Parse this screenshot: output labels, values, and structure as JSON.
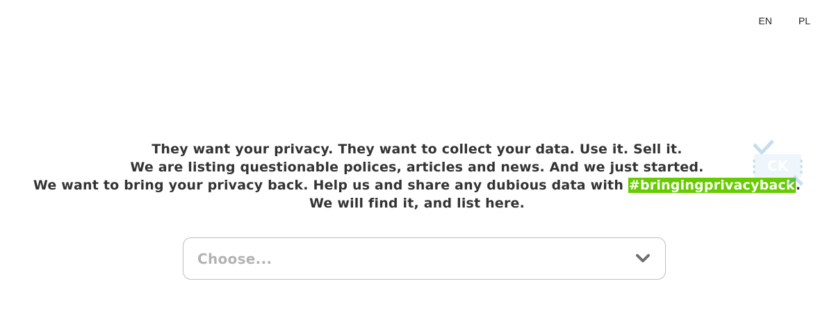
{
  "header": {
    "languages": [
      {
        "label": "EN"
      },
      {
        "label": "PL"
      }
    ]
  },
  "manifesto": {
    "line1": "They want your privacy. They want to collect your data. Use it. Sell it.",
    "line2": "We are listing questionable polices, articles and news. And we just started.",
    "line3_prefix": "We want to bring your privacy back. Help us and share any dubious data with ",
    "hashtag": "#bringingprivacyback",
    "line3_suffix": ".",
    "line4": "We will find it, and list here."
  },
  "watermark": {
    "text": "CK",
    "icon": "checkmark-logo-icon"
  },
  "category_select": {
    "placeholder": "Choose..."
  },
  "colors": {
    "hashtag_bg": "#66cc00",
    "text": "#333333",
    "placeholder": "#b3b3b3",
    "border": "#bdbdbd",
    "watermark": "#a6cde8"
  }
}
